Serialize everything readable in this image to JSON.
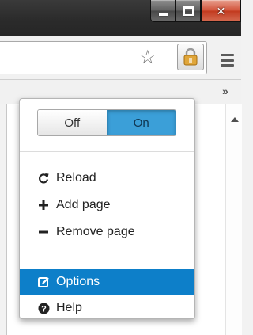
{
  "window": {
    "controls": [
      "minimize-icon",
      "maximize-icon",
      "close-icon"
    ]
  },
  "toolbar": {
    "bookmark_icon": "star-icon",
    "extension_icon": "lock-icon",
    "menu_icon": "hamburger-icon",
    "overflow_chevron": "»"
  },
  "popup": {
    "toggle": {
      "off_label": "Off",
      "on_label": "On",
      "selected": "On"
    },
    "items": [
      {
        "label": "Reload",
        "icon": "refresh-icon"
      },
      {
        "label": "Add page",
        "icon": "plus-icon"
      },
      {
        "label": "Remove page",
        "icon": "minus-icon"
      }
    ],
    "footer_items": [
      {
        "label": "Options",
        "icon": "edit-icon",
        "highlighted": true
      },
      {
        "label": "Help",
        "icon": "question-icon"
      }
    ],
    "colors": {
      "accent": "#0d7fc9",
      "toggle_on": "#3b9fd8"
    }
  }
}
